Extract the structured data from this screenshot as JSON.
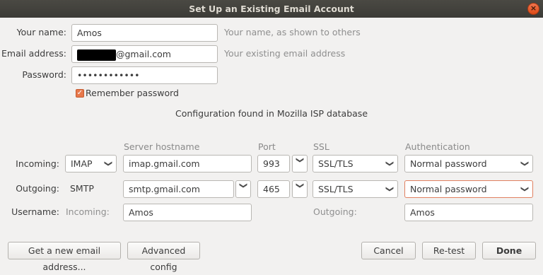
{
  "window": {
    "title": "Set Up an Existing Email Account",
    "close_glyph": "×"
  },
  "identity": {
    "name_label": "Your name:",
    "name_value": "Amos",
    "name_hint": "Your name, as shown to others",
    "email_label": "Email address:",
    "email_visible_suffix": "@gmail.com",
    "email_hint": "Your existing email address",
    "password_label": "Password:",
    "password_value": "••••••••••••",
    "remember_label": "Remember password",
    "remember_checked": true
  },
  "status_message": "Configuration found in Mozilla ISP database",
  "columns": {
    "server": "Server hostname",
    "port": "Port",
    "ssl": "SSL",
    "auth": "Authentication"
  },
  "incoming": {
    "label": "Incoming:",
    "protocol": "IMAP",
    "hostname": "imap.gmail.com",
    "port": "993",
    "ssl": "SSL/TLS",
    "auth": "Normal password"
  },
  "outgoing": {
    "label": "Outgoing:",
    "protocol": "SMTP",
    "hostname": "smtp.gmail.com",
    "port": "465",
    "ssl": "SSL/TLS",
    "auth": "Normal password"
  },
  "username": {
    "label": "Username:",
    "incoming_label": "Incoming:",
    "incoming_value": "Amos",
    "outgoing_label": "Outgoing:",
    "outgoing_value": "Amos"
  },
  "buttons": {
    "new_address": "Get a new email address...",
    "advanced": "Advanced config",
    "cancel": "Cancel",
    "retest": "Re-test",
    "done": "Done"
  },
  "icons": {
    "dropdown": "chevron-down-icon",
    "checkbox": "checkmark-icon"
  },
  "colors": {
    "titlebar": "#3c3b37",
    "accent": "#e7784b",
    "background": "#f2f1f0"
  }
}
